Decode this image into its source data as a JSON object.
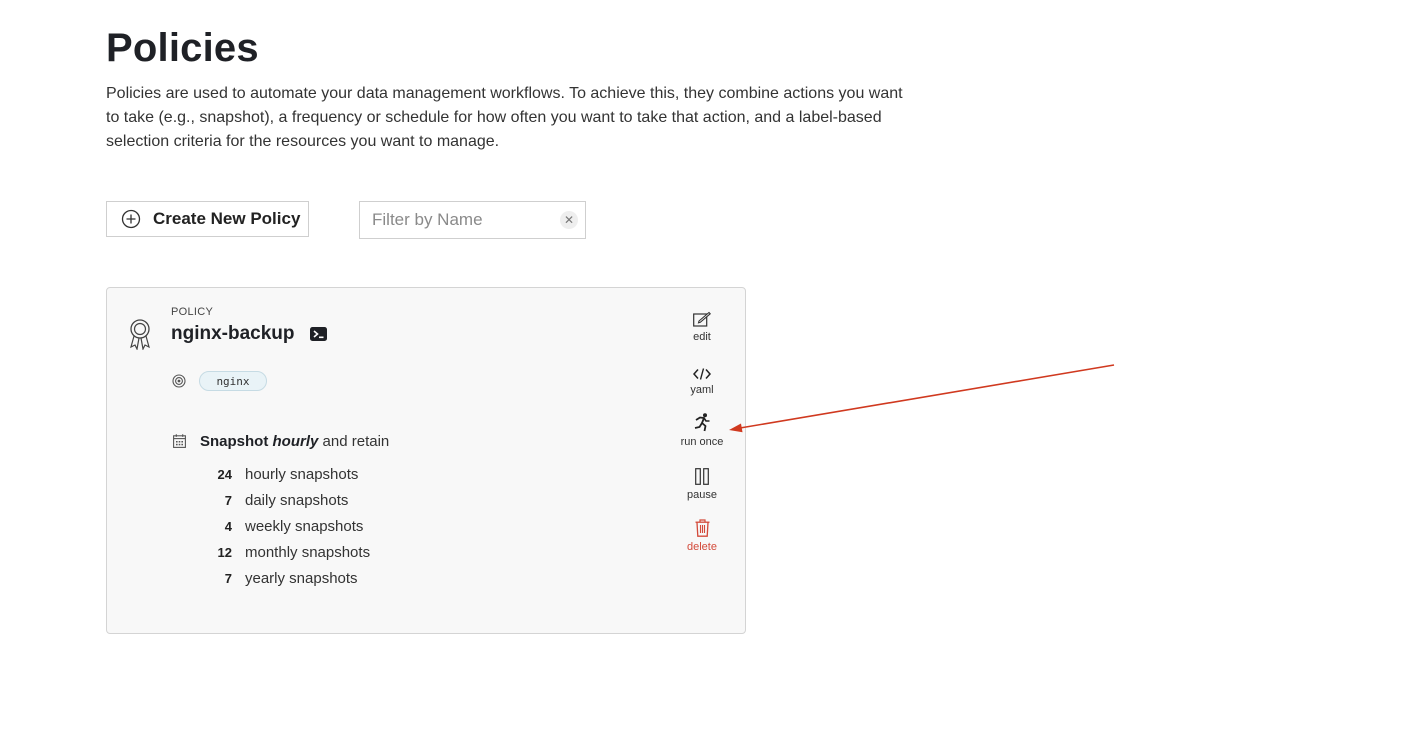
{
  "page": {
    "title": "Policies",
    "description": "Policies are used to automate your data management workflows. To achieve this, they combine actions you want to take (e.g., snapshot), a frequency or schedule for how often you want to take that action, and a label-based selection criteria for the resources you want to manage."
  },
  "toolbar": {
    "create_label": "Create New Policy",
    "filter_placeholder": "Filter by Name",
    "filter_value": ""
  },
  "policy": {
    "kind_label": "POLICY",
    "name": "nginx-backup",
    "selector_tag": "nginx",
    "action_word": "Snapshot",
    "frequency": "hourly",
    "retain_word": "and retain",
    "retention": [
      {
        "count": "24",
        "label": "hourly snapshots"
      },
      {
        "count": "7",
        "label": "daily snapshots"
      },
      {
        "count": "4",
        "label": "weekly snapshots"
      },
      {
        "count": "12",
        "label": "monthly snapshots"
      },
      {
        "count": "7",
        "label": "yearly snapshots"
      }
    ],
    "actions": {
      "edit": "edit",
      "yaml": "yaml",
      "run_once": "run once",
      "pause": "pause",
      "delete": "delete"
    }
  },
  "colors": {
    "annotation_arrow": "#d0391f",
    "delete": "#d34a3a",
    "tag_bg": "#e9f3f7"
  }
}
